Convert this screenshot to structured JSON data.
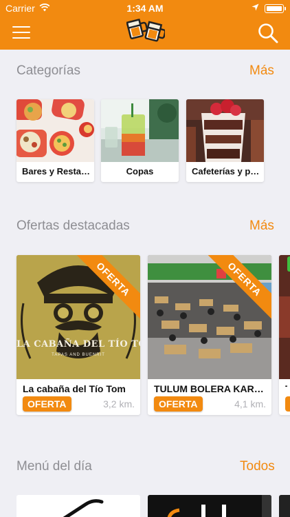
{
  "status_bar": {
    "carrier": "Carrier",
    "time": "1:34 AM"
  },
  "header": {
    "menu_icon": "hamburger-menu-icon",
    "logo_icon": "beer-mugs-logo",
    "search_icon": "search-icon"
  },
  "sections": {
    "categories": {
      "title": "Categorías",
      "link": "Más"
    },
    "offers": {
      "title": "Ofertas destacadas",
      "link": "Más"
    },
    "menu": {
      "title": "Menú del día",
      "link": "Todos"
    }
  },
  "categories": [
    {
      "label": "Bares y Restaurantes"
    },
    {
      "label": "Copas"
    },
    {
      "label": "Cafeterías y postres"
    }
  ],
  "offers": [
    {
      "name": "La cabaña del Tío Tom",
      "badge": "OFERTA",
      "distance": "3,2 km.",
      "ribbon": "OFERTA",
      "image_title": "LA CABAÑA DEL TÍO TOM",
      "image_subtitle": "TAPAS AND BUENRIT"
    },
    {
      "name": "TULUM BOLERA KARAOKE",
      "badge": "OFERTA",
      "distance": "4,1 km.",
      "ribbon": "OFERTA"
    },
    {
      "name": "T",
      "badge": "",
      "distance": ""
    }
  ],
  "colors": {
    "accent": "#f28a10",
    "background": "#efeff4",
    "secondary_text": "#8e8e93"
  }
}
